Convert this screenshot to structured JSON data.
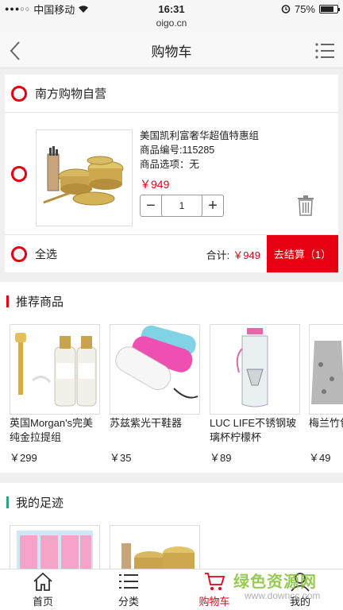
{
  "status": {
    "carrier": "中国移动",
    "time": "16:31",
    "battery": "75%",
    "url": "oigo.cn"
  },
  "nav": {
    "title": "购物车"
  },
  "cart": {
    "shop_name": "南方购物自营",
    "item": {
      "title": "美国凯利富奢华超值特惠组",
      "code": "商品编号:115285",
      "option": "商品选项：无",
      "price": "￥949",
      "quantity": "1"
    },
    "select_all": "全选",
    "total_label": "合计:",
    "total_amount": "￥949",
    "checkout_label": "去结算（1）"
  },
  "recommend": {
    "title": "推荐商品",
    "products": [
      {
        "name": "英国Morgan's完美纯金拉提组",
        "price": "￥299"
      },
      {
        "name": "苏兹紫光干鞋器",
        "price": "￥35"
      },
      {
        "name": "LUC LIFE不锈钢玻璃杯柠檬杯",
        "price": "￥89"
      },
      {
        "name": "梅兰竹包方套",
        "price": "￥49"
      }
    ]
  },
  "footprint": {
    "title": "我的足迹"
  },
  "tabs": [
    {
      "label": "首页",
      "icon": "home-icon"
    },
    {
      "label": "分类",
      "icon": "list-icon"
    },
    {
      "label": "购物车",
      "icon": "cart-icon"
    },
    {
      "label": "我的",
      "icon": "user-icon"
    }
  ],
  "watermark": {
    "line1": "绿色资源网",
    "line2": "www.downcc.com"
  },
  "colors": {
    "accent": "#e60012",
    "recommend_bar": "#e60012",
    "footprint_bar": "#2aa57a",
    "watermark": "#7ebc2c"
  }
}
